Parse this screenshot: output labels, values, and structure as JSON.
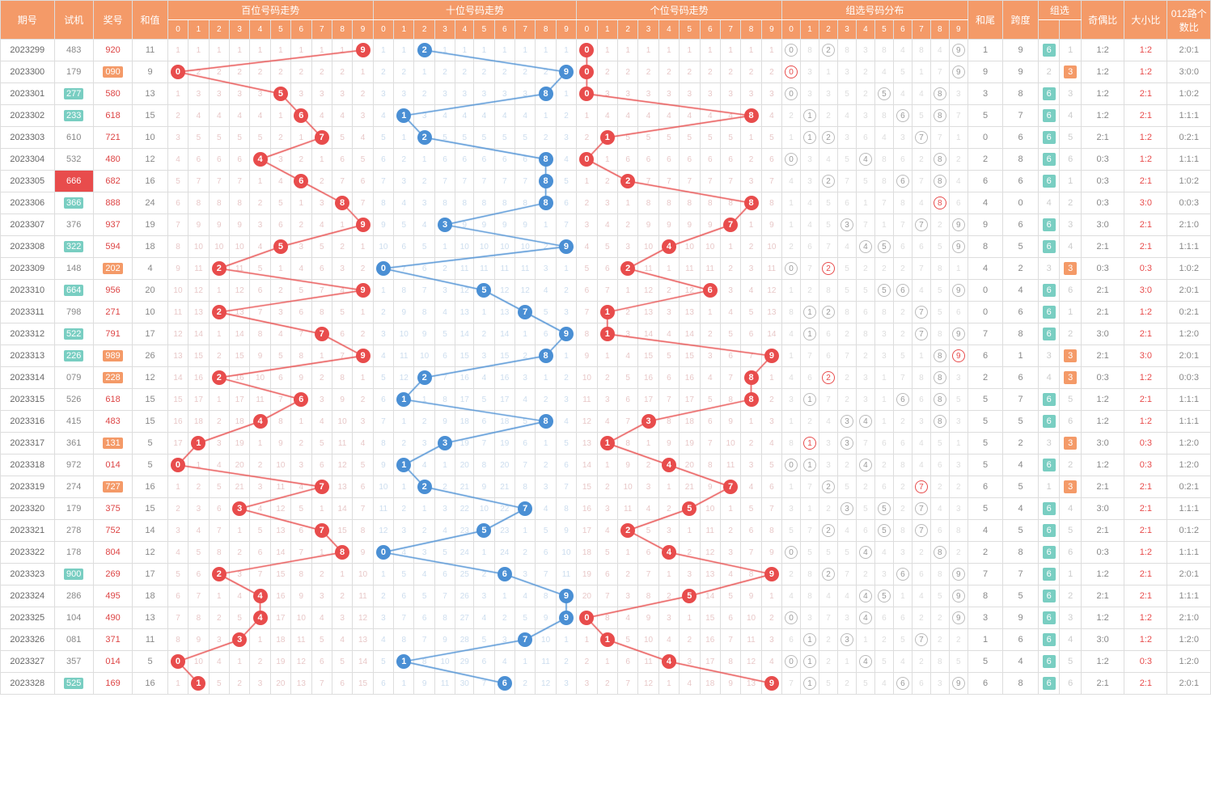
{
  "headers": {
    "issue": "期号",
    "shiji": "试机",
    "jh": "奖号",
    "sum": "和值",
    "bai": "百位号码走势",
    "shi": "十位号码走势",
    "ge": "个位号码走势",
    "group": "组选号码分布",
    "tail": "和尾",
    "span": "跨度",
    "select": "组选",
    "oe": "奇偶比",
    "bs": "大小比",
    "route": "012路个数比"
  },
  "rows": [
    {
      "issue": "2023299",
      "shiji": "483",
      "shijiStyle": "n",
      "jh": "920",
      "jhStyle": "n",
      "sum": "11",
      "bai": 9,
      "shi": 2,
      "ge": 0,
      "group": [
        0,
        2,
        9
      ],
      "tail": "1",
      "span": "9",
      "sel6": "6",
      "sel3": "",
      "oe": "1:2",
      "oeR": 0,
      "bs": "1:2",
      "bsR": 1,
      "route": "2:0:1"
    },
    {
      "issue": "2023300",
      "shiji": "179",
      "shijiStyle": "n",
      "jh": "090",
      "jhStyle": "h",
      "sum": "9",
      "bai": 0,
      "shi": 9,
      "ge": 0,
      "group": [
        0,
        9
      ],
      "groupRed": [
        0
      ],
      "tail": "9",
      "span": "9",
      "sel6": "",
      "sel3": "3",
      "oe": "1:2",
      "oeR": 0,
      "bs": "1:2",
      "bsR": 1,
      "route": "3:0:0"
    },
    {
      "issue": "2023301",
      "shiji": "277",
      "shijiStyle": "h",
      "jh": "580",
      "jhStyle": "n",
      "sum": "13",
      "bai": 5,
      "shi": 8,
      "ge": 0,
      "group": [
        0,
        5,
        8
      ],
      "tail": "3",
      "span": "8",
      "sel6": "6",
      "sel3": "",
      "oe": "1:2",
      "oeR": 0,
      "bs": "2:1",
      "bsR": 1,
      "route": "1:0:2"
    },
    {
      "issue": "2023302",
      "shiji": "233",
      "shijiStyle": "h",
      "jh": "618",
      "jhStyle": "n",
      "sum": "15",
      "bai": 6,
      "shi": 1,
      "ge": 8,
      "group": [
        1,
        6,
        8
      ],
      "tail": "5",
      "span": "7",
      "sel6": "6",
      "sel3": "",
      "oe": "1:2",
      "oeR": 0,
      "bs": "2:1",
      "bsR": 1,
      "route": "1:1:1"
    },
    {
      "issue": "2023303",
      "shiji": "610",
      "shijiStyle": "n",
      "jh": "721",
      "jhStyle": "n",
      "sum": "10",
      "bai": 7,
      "shi": 2,
      "ge": 1,
      "group": [
        1,
        2,
        7
      ],
      "tail": "0",
      "span": "6",
      "sel6": "6",
      "sel3": "",
      "oe": "2:1",
      "oeR": 0,
      "bs": "1:2",
      "bsR": 1,
      "route": "0:2:1"
    },
    {
      "issue": "2023304",
      "shiji": "532",
      "shijiStyle": "n",
      "jh": "480",
      "jhStyle": "n",
      "sum": "12",
      "bai": 4,
      "shi": 8,
      "ge": 0,
      "group": [
        0,
        4,
        8
      ],
      "tail": "2",
      "span": "8",
      "sel6": "6",
      "sel3": "",
      "oe": "0:3",
      "oeR": 0,
      "bs": "1:2",
      "bsR": 1,
      "route": "1:1:1"
    },
    {
      "issue": "2023305",
      "shiji": "666",
      "shijiStyle": "r",
      "jh": "682",
      "jhStyle": "n",
      "sum": "16",
      "bai": 6,
      "shi": 8,
      "ge": 2,
      "group": [
        2,
        6,
        8
      ],
      "tail": "6",
      "span": "6",
      "sel6": "6",
      "sel3": "",
      "oe": "0:3",
      "oeR": 0,
      "bs": "2:1",
      "bsR": 1,
      "route": "1:0:2"
    },
    {
      "issue": "2023306",
      "shiji": "366",
      "shijiStyle": "h",
      "jh": "888",
      "jhStyle": "n",
      "sum": "24",
      "bai": 8,
      "shi": 8,
      "ge": 8,
      "group": [
        8
      ],
      "groupRed": [
        8
      ],
      "tail": "4",
      "span": "0",
      "sel6": "",
      "sel3": "",
      "oe": "0:3",
      "oeR": 0,
      "bs": "3:0",
      "bsR": 1,
      "route": "0:0:3"
    },
    {
      "issue": "2023307",
      "shiji": "376",
      "shijiStyle": "n",
      "jh": "937",
      "jhStyle": "n",
      "sum": "19",
      "bai": 9,
      "shi": 3,
      "ge": 7,
      "group": [
        3,
        7,
        9
      ],
      "tail": "9",
      "span": "6",
      "sel6": "6",
      "sel3": "",
      "oe": "3:0",
      "oeR": 0,
      "bs": "2:1",
      "bsR": 1,
      "route": "2:1:0"
    },
    {
      "issue": "2023308",
      "shiji": "322",
      "shijiStyle": "h",
      "jh": "594",
      "jhStyle": "n",
      "sum": "18",
      "bai": 5,
      "shi": 9,
      "ge": 4,
      "group": [
        4,
        5,
        9
      ],
      "tail": "8",
      "span": "5",
      "sel6": "6",
      "sel3": "",
      "oe": "2:1",
      "oeR": 0,
      "bs": "2:1",
      "bsR": 1,
      "route": "1:1:1"
    },
    {
      "issue": "2023309",
      "shiji": "148",
      "shijiStyle": "n",
      "jh": "202",
      "jhStyle": "h",
      "sum": "4",
      "bai": 2,
      "shi": 0,
      "ge": 2,
      "group": [
        0,
        2
      ],
      "groupRed": [
        2
      ],
      "tail": "4",
      "span": "2",
      "sel6": "",
      "sel3": "3",
      "oe": "0:3",
      "oeR": 0,
      "bs": "0:3",
      "bsR": 1,
      "route": "1:0:2"
    },
    {
      "issue": "2023310",
      "shiji": "664",
      "shijiStyle": "h",
      "jh": "956",
      "jhStyle": "n",
      "sum": "20",
      "bai": 9,
      "shi": 5,
      "ge": 6,
      "group": [
        5,
        6,
        9
      ],
      "tail": "0",
      "span": "4",
      "sel6": "6",
      "sel3": "",
      "oe": "2:1",
      "oeR": 0,
      "bs": "3:0",
      "bsR": 1,
      "route": "2:0:1"
    },
    {
      "issue": "2023311",
      "shiji": "798",
      "shijiStyle": "n",
      "jh": "271",
      "jhStyle": "n",
      "sum": "10",
      "bai": 2,
      "shi": 7,
      "ge": 1,
      "group": [
        1,
        2,
        7
      ],
      "tail": "0",
      "span": "6",
      "sel6": "6",
      "sel3": "",
      "oe": "2:1",
      "oeR": 0,
      "bs": "1:2",
      "bsR": 1,
      "route": "0:2:1"
    },
    {
      "issue": "2023312",
      "shiji": "522",
      "shijiStyle": "h",
      "jh": "791",
      "jhStyle": "n",
      "sum": "17",
      "bai": 7,
      "shi": 9,
      "ge": 1,
      "group": [
        1,
        7,
        9
      ],
      "tail": "7",
      "span": "8",
      "sel6": "6",
      "sel3": "",
      "oe": "3:0",
      "oeR": 0,
      "bs": "2:1",
      "bsR": 1,
      "route": "1:2:0"
    },
    {
      "issue": "2023313",
      "shiji": "226",
      "shijiStyle": "h",
      "jh": "989",
      "jhStyle": "h",
      "sum": "26",
      "bai": 9,
      "shi": 8,
      "ge": 9,
      "group": [
        8,
        9
      ],
      "groupRed": [
        9
      ],
      "tail": "6",
      "span": "1",
      "sel6": "",
      "sel3": "3",
      "oe": "2:1",
      "oeR": 0,
      "bs": "3:0",
      "bsR": 1,
      "route": "2:0:1"
    },
    {
      "issue": "2023314",
      "shiji": "079",
      "shijiStyle": "n",
      "jh": "228",
      "jhStyle": "h",
      "sum": "12",
      "bai": 2,
      "shi": 2,
      "ge": 8,
      "group": [
        2,
        8
      ],
      "groupRed": [
        2
      ],
      "tail": "2",
      "span": "6",
      "sel6": "",
      "sel3": "3",
      "oe": "0:3",
      "oeR": 0,
      "bs": "1:2",
      "bsR": 1,
      "route": "0:0:3"
    },
    {
      "issue": "2023315",
      "shiji": "526",
      "shijiStyle": "n",
      "jh": "618",
      "jhStyle": "n",
      "sum": "15",
      "bai": 6,
      "shi": 1,
      "ge": 8,
      "group": [
        1,
        6,
        8
      ],
      "tail": "5",
      "span": "7",
      "sel6": "6",
      "sel3": "",
      "oe": "1:2",
      "oeR": 0,
      "bs": "2:1",
      "bsR": 1,
      "route": "1:1:1"
    },
    {
      "issue": "2023316",
      "shiji": "415",
      "shijiStyle": "n",
      "jh": "483",
      "jhStyle": "n",
      "sum": "15",
      "bai": 4,
      "shi": 8,
      "ge": 3,
      "group": [
        3,
        4,
        8
      ],
      "tail": "5",
      "span": "5",
      "sel6": "6",
      "sel3": "",
      "oe": "1:2",
      "oeR": 0,
      "bs": "1:2",
      "bsR": 1,
      "route": "1:1:1"
    },
    {
      "issue": "2023317",
      "shiji": "361",
      "shijiStyle": "n",
      "jh": "131",
      "jhStyle": "h",
      "sum": "5",
      "bai": 1,
      "shi": 3,
      "ge": 1,
      "group": [
        1,
        3
      ],
      "groupRed": [
        1
      ],
      "tail": "5",
      "span": "2",
      "sel6": "",
      "sel3": "3",
      "oe": "3:0",
      "oeR": 0,
      "bs": "0:3",
      "bsR": 1,
      "route": "1:2:0"
    },
    {
      "issue": "2023318",
      "shiji": "972",
      "shijiStyle": "n",
      "jh": "014",
      "jhStyle": "n",
      "sum": "5",
      "bai": 0,
      "shi": 1,
      "ge": 4,
      "group": [
        0,
        1,
        4
      ],
      "tail": "5",
      "span": "4",
      "sel6": "6",
      "sel3": "",
      "oe": "1:2",
      "oeR": 0,
      "bs": "0:3",
      "bsR": 1,
      "route": "1:2:0"
    },
    {
      "issue": "2023319",
      "shiji": "274",
      "shijiStyle": "n",
      "jh": "727",
      "jhStyle": "h",
      "sum": "16",
      "bai": 7,
      "shi": 2,
      "ge": 7,
      "group": [
        2,
        7
      ],
      "groupRed": [
        7
      ],
      "tail": "6",
      "span": "5",
      "sel6": "",
      "sel3": "3",
      "oe": "2:1",
      "oeR": 0,
      "bs": "2:1",
      "bsR": 1,
      "route": "0:2:1"
    },
    {
      "issue": "2023320",
      "shiji": "179",
      "shijiStyle": "n",
      "jh": "375",
      "jhStyle": "n",
      "sum": "15",
      "bai": 3,
      "shi": 7,
      "ge": 5,
      "group": [
        3,
        5,
        7
      ],
      "tail": "5",
      "span": "4",
      "sel6": "6",
      "sel3": "",
      "oe": "3:0",
      "oeR": 0,
      "bs": "2:1",
      "bsR": 1,
      "route": "1:1:1"
    },
    {
      "issue": "2023321",
      "shiji": "278",
      "shijiStyle": "n",
      "jh": "752",
      "jhStyle": "n",
      "sum": "14",
      "bai": 7,
      "shi": 5,
      "ge": 2,
      "group": [
        2,
        5,
        7
      ],
      "tail": "4",
      "span": "5",
      "sel6": "6",
      "sel3": "",
      "oe": "2:1",
      "oeR": 0,
      "bs": "2:1",
      "bsR": 1,
      "route": "0:1:2"
    },
    {
      "issue": "2023322",
      "shiji": "178",
      "shijiStyle": "n",
      "jh": "804",
      "jhStyle": "n",
      "sum": "12",
      "bai": 8,
      "shi": 0,
      "ge": 4,
      "group": [
        0,
        4,
        8
      ],
      "tail": "2",
      "span": "8",
      "sel6": "6",
      "sel3": "",
      "oe": "0:3",
      "oeR": 0,
      "bs": "1:2",
      "bsR": 1,
      "route": "1:1:1"
    },
    {
      "issue": "2023323",
      "shiji": "900",
      "shijiStyle": "h",
      "jh": "269",
      "jhStyle": "n",
      "sum": "17",
      "bai": 2,
      "shi": 6,
      "ge": 9,
      "group": [
        2,
        6,
        9
      ],
      "tail": "7",
      "span": "7",
      "sel6": "6",
      "sel3": "",
      "oe": "1:2",
      "oeR": 0,
      "bs": "2:1",
      "bsR": 1,
      "route": "2:0:1"
    },
    {
      "issue": "2023324",
      "shiji": "286",
      "shijiStyle": "n",
      "jh": "495",
      "jhStyle": "n",
      "sum": "18",
      "bai": 4,
      "shi": 9,
      "ge": 5,
      "group": [
        4,
        5,
        9
      ],
      "tail": "8",
      "span": "5",
      "sel6": "6",
      "sel3": "",
      "oe": "2:1",
      "oeR": 0,
      "bs": "2:1",
      "bsR": 1,
      "route": "1:1:1"
    },
    {
      "issue": "2023325",
      "shiji": "104",
      "shijiStyle": "n",
      "jh": "490",
      "jhStyle": "n",
      "sum": "13",
      "bai": 4,
      "shi": 9,
      "ge": 0,
      "group": [
        0,
        4,
        9
      ],
      "tail": "3",
      "span": "9",
      "sel6": "6",
      "sel3": "",
      "oe": "1:2",
      "oeR": 0,
      "bs": "1:2",
      "bsR": 1,
      "route": "2:1:0"
    },
    {
      "issue": "2023326",
      "shiji": "081",
      "shijiStyle": "n",
      "jh": "371",
      "jhStyle": "n",
      "sum": "11",
      "bai": 3,
      "shi": 7,
      "ge": 1,
      "group": [
        1,
        3,
        7
      ],
      "tail": "1",
      "span": "6",
      "sel6": "6",
      "sel3": "",
      "oe": "3:0",
      "oeR": 0,
      "bs": "1:2",
      "bsR": 1,
      "route": "1:2:0"
    },
    {
      "issue": "2023327",
      "shiji": "357",
      "shijiStyle": "n",
      "jh": "014",
      "jhStyle": "n",
      "sum": "5",
      "bai": 0,
      "shi": 1,
      "ge": 4,
      "group": [
        0,
        1,
        4
      ],
      "tail": "5",
      "span": "4",
      "sel6": "6",
      "sel3": "",
      "oe": "1:2",
      "oeR": 0,
      "bs": "0:3",
      "bsR": 1,
      "route": "1:2:0"
    },
    {
      "issue": "2023328",
      "shiji": "525",
      "shijiStyle": "h",
      "jh": "169",
      "jhStyle": "n",
      "sum": "16",
      "bai": 1,
      "shi": 6,
      "ge": 9,
      "group": [
        1,
        6,
        9
      ],
      "tail": "6",
      "span": "8",
      "sel6": "6",
      "sel3": "",
      "oe": "2:1",
      "oeR": 0,
      "bs": "2:1",
      "bsR": 1,
      "route": "2:0:1"
    }
  ]
}
